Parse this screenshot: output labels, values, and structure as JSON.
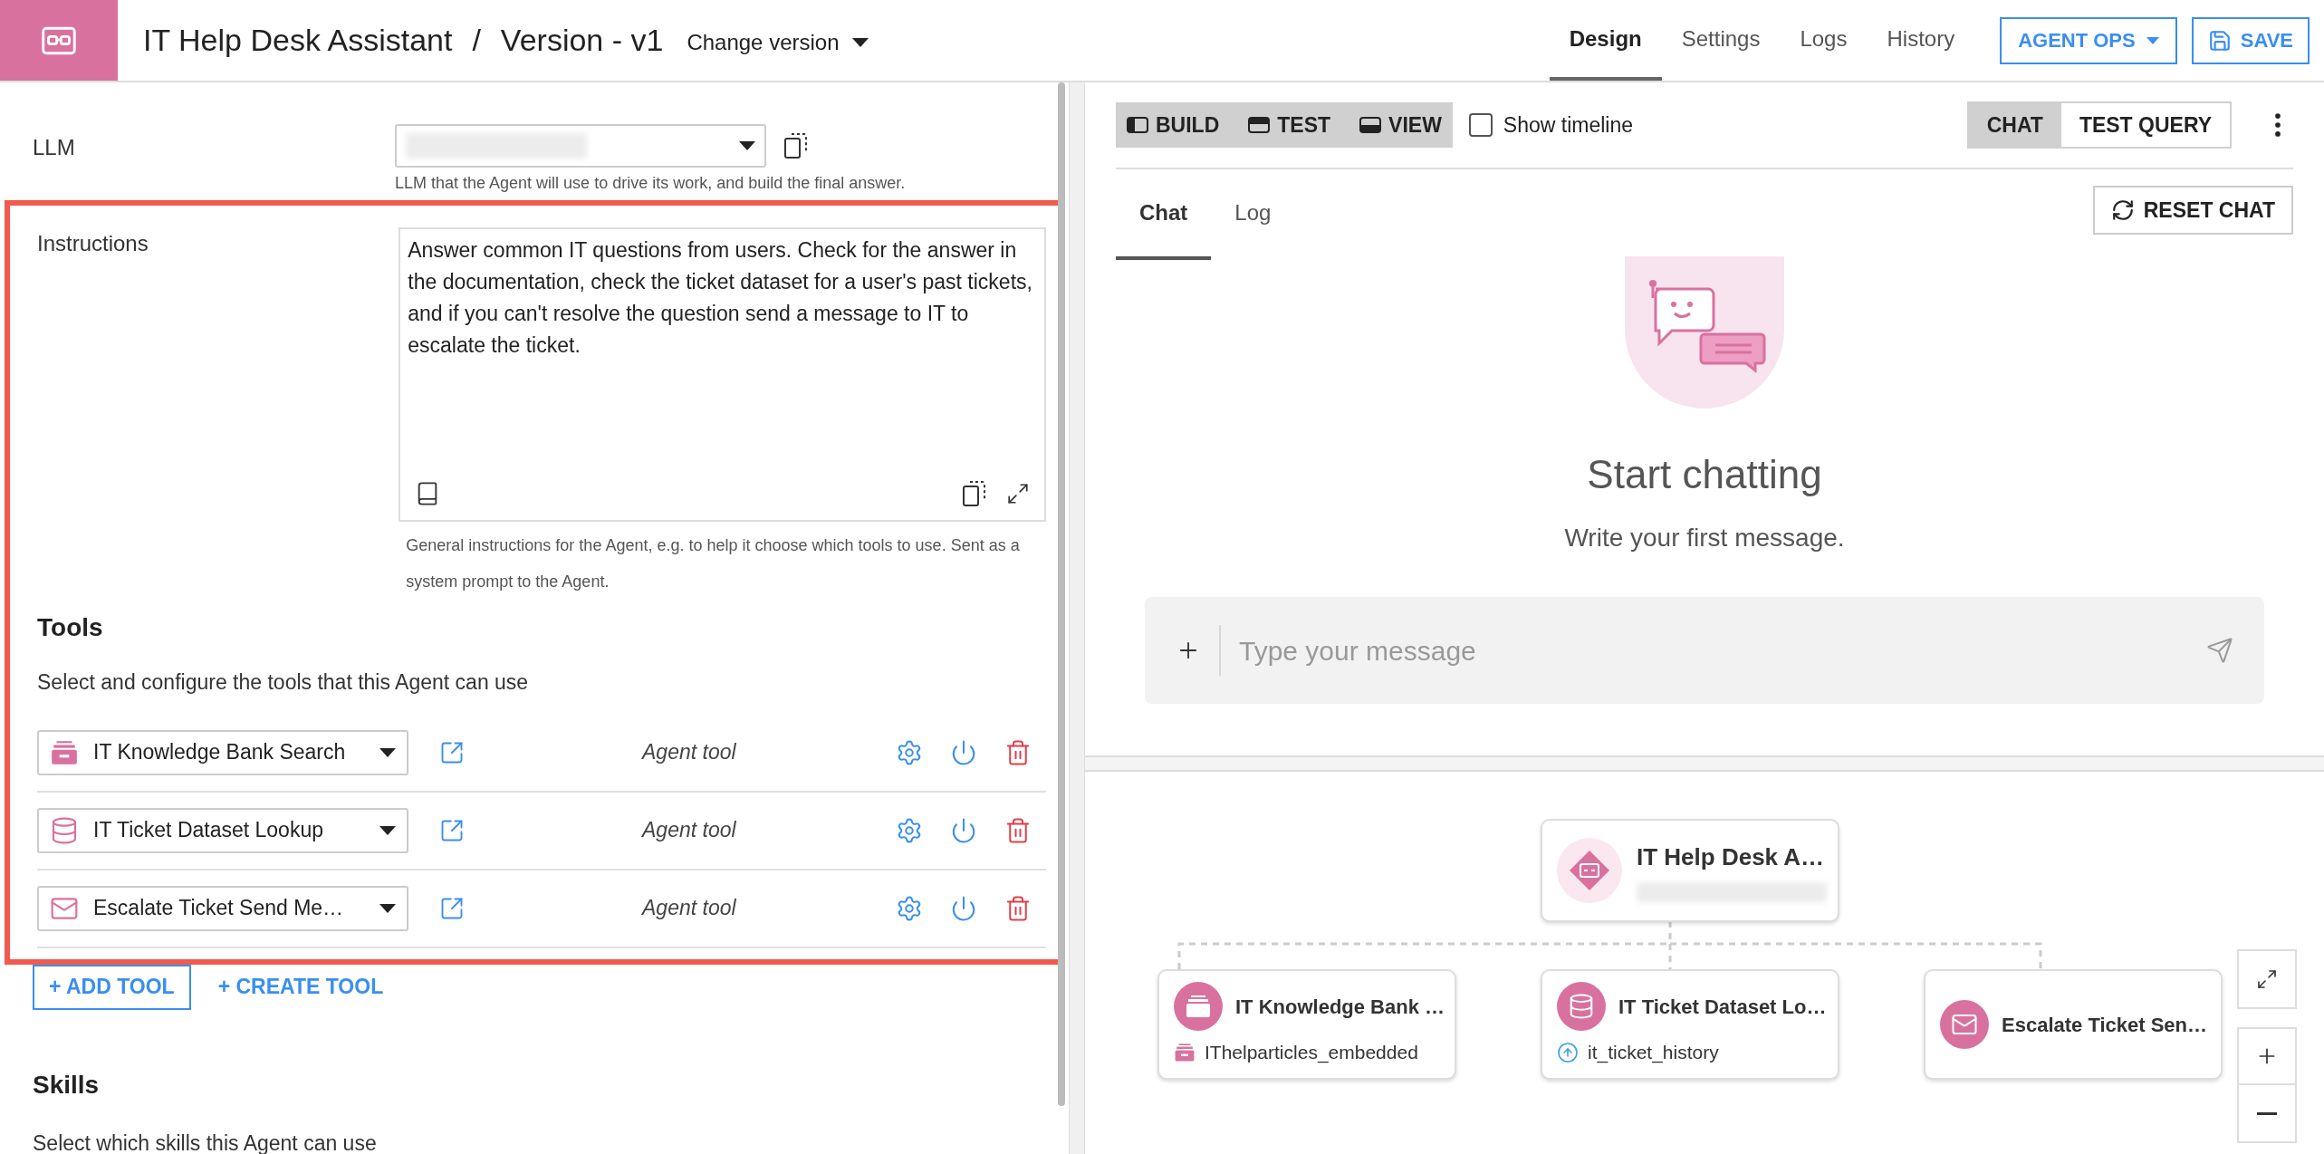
{
  "header": {
    "title": "IT Help Desk Assistant",
    "separator": "/",
    "version": "Version - v1",
    "version_menu": "Change version",
    "tabs": [
      {
        "label": "Design",
        "selected": true
      },
      {
        "label": "Settings",
        "selected": false
      },
      {
        "label": "Logs",
        "selected": false
      },
      {
        "label": "History",
        "selected": false
      }
    ],
    "agent_ops": "AGENT OPS",
    "save": "SAVE"
  },
  "llm": {
    "label": "LLM",
    "help": "LLM that the Agent will use to drive its work, and build the final answer."
  },
  "instructions": {
    "label": "Instructions",
    "value": "Answer common IT questions from users. Check for the answer in the documentation, check the ticket dataset for a user's past tickets, and if you can't resolve the question send a message to IT to escalate the ticket.",
    "help": "General instructions for the Agent, e.g. to help it choose which tools to use. Sent as a system prompt to the Agent."
  },
  "tools": {
    "title": "Tools",
    "description": "Select and configure the tools that this Agent can use",
    "items": [
      {
        "name": "IT Knowledge Bank Search",
        "kind": "knowledge",
        "type_label": "Agent tool"
      },
      {
        "name": "IT Ticket Dataset Lookup",
        "kind": "dataset",
        "type_label": "Agent tool"
      },
      {
        "name": "Escalate Ticket Send Me…",
        "kind": "mail",
        "type_label": "Agent tool"
      }
    ],
    "add": "+ ADD TOOL",
    "create": "+ CREATE TOOL"
  },
  "skills": {
    "title": "Skills",
    "description": "Select which skills this Agent can use"
  },
  "panel": {
    "modes": [
      {
        "label": "BUILD",
        "kind": "build"
      },
      {
        "label": "TEST",
        "kind": "test"
      },
      {
        "label": "VIEW",
        "kind": "view"
      }
    ],
    "show_timeline": {
      "label": "Show timeline",
      "checked": false
    },
    "view_toggle": [
      {
        "label": "CHAT",
        "selected": true
      },
      {
        "label": "TEST QUERY",
        "selected": false
      }
    ],
    "tabs": [
      {
        "label": "Chat",
        "selected": true
      },
      {
        "label": "Log",
        "selected": false
      }
    ],
    "reset": "RESET CHAT",
    "empty_title": "Start chatting",
    "empty_text": "Write your first message.",
    "message_placeholder": "Type your message"
  },
  "graph": {
    "root": {
      "title": "IT Help Desk A…"
    },
    "nodes": [
      {
        "title": "IT Knowledge Bank …",
        "source": "IThelparticles_embedded",
        "kind": "knowledge"
      },
      {
        "title": "IT Ticket Dataset Lo…",
        "source": "it_ticket_history",
        "kind": "dataset"
      },
      {
        "title": "Escalate Ticket Sen…",
        "kind": "mail"
      }
    ]
  }
}
